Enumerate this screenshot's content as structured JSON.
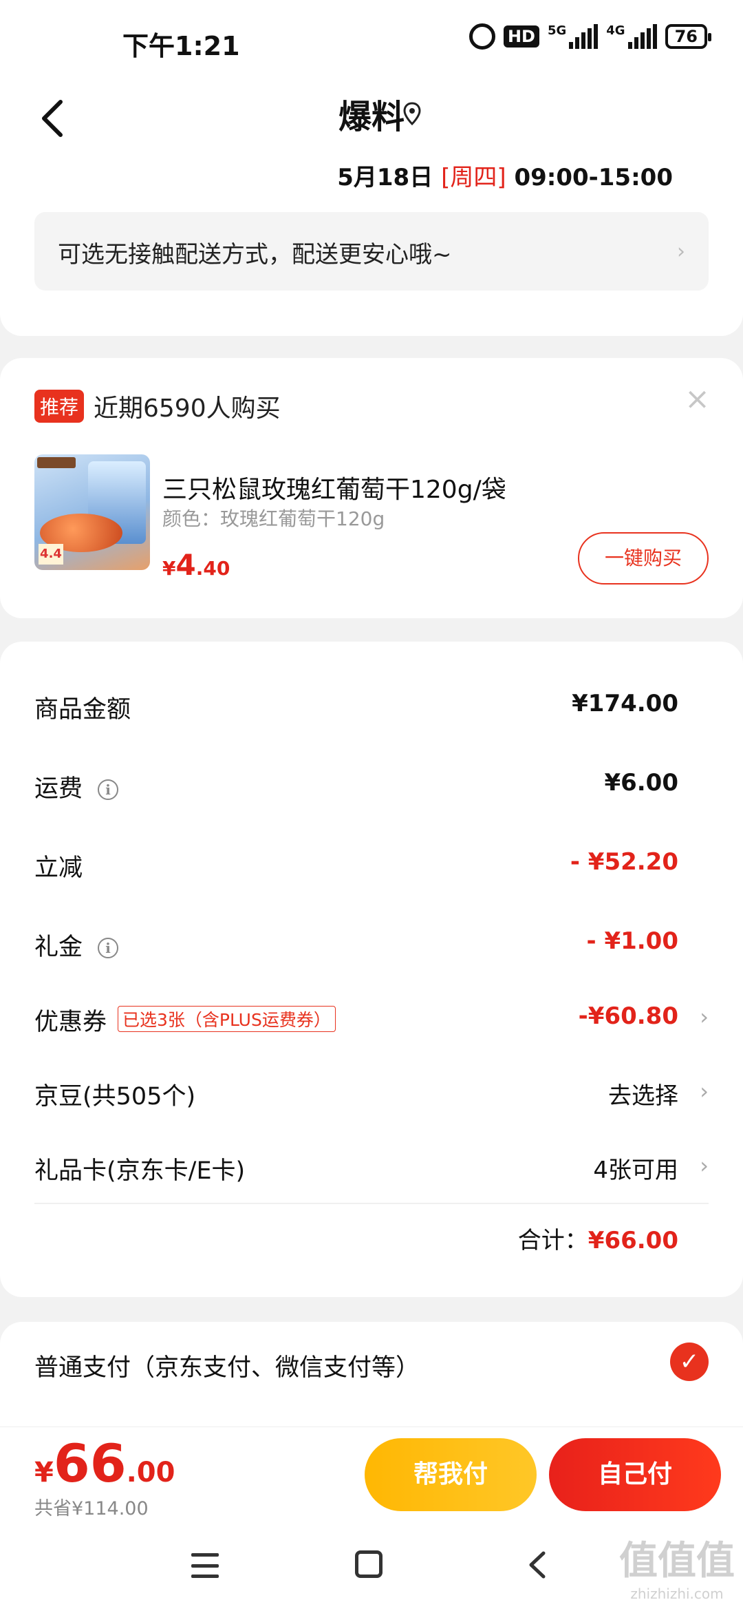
{
  "status_bar": {
    "time": "下午1:21",
    "hd": "HD",
    "net1": "5G",
    "net2": "4G",
    "battery": "76"
  },
  "header": {
    "title": "爆料",
    "delivery_date": "5月18日",
    "delivery_weekday": "[周四]",
    "delivery_window": "09:00-15:00"
  },
  "notice": {
    "text": "可选无接触配送方式，配送更安心哦~",
    "arrow": "›"
  },
  "recommend": {
    "tag": "推荐",
    "text": "近期6590人购买",
    "close": "×",
    "product": {
      "name": "三只松鼠玫瑰红葡萄干120g/袋",
      "spec": "颜色：玫瑰红葡萄干120g",
      "price_symbol": "¥",
      "price_int": "4",
      "price_dec": ".40",
      "badge": "4.4",
      "buy_label": "一键购买"
    }
  },
  "amounts": {
    "rows": [
      {
        "label": "商品金额",
        "value": "¥174.00"
      },
      {
        "label": "运费",
        "value": "¥6.00"
      },
      {
        "label": "立减",
        "value": "- ¥52.20"
      },
      {
        "label": "礼金",
        "value": "- ¥1.00"
      },
      {
        "label": "优惠券",
        "tag": "已选3张（含PLUS运费券）",
        "value": "-¥60.80"
      },
      {
        "label": "京豆(共505个)",
        "value": "去选择"
      },
      {
        "label": "礼品卡(京东卡/E卡)",
        "value": "4张可用"
      }
    ],
    "total_label": "合计：",
    "total_value": "¥66.00"
  },
  "payment": {
    "method": "普通支付（京东支付、微信支付等）",
    "check": "✓"
  },
  "bottom": {
    "price_symbol": "¥",
    "price_int": "66",
    "price_dec": ".00",
    "saved": "共省¥114.00",
    "help_pay": "帮我付",
    "self_pay": "自己付"
  },
  "watermark": {
    "text": "值值值",
    "sub": "zhizhizhi.com"
  },
  "colors": {
    "accent": "#e2231a",
    "help_button": "#ffc727",
    "self_button": "#e8211b"
  }
}
